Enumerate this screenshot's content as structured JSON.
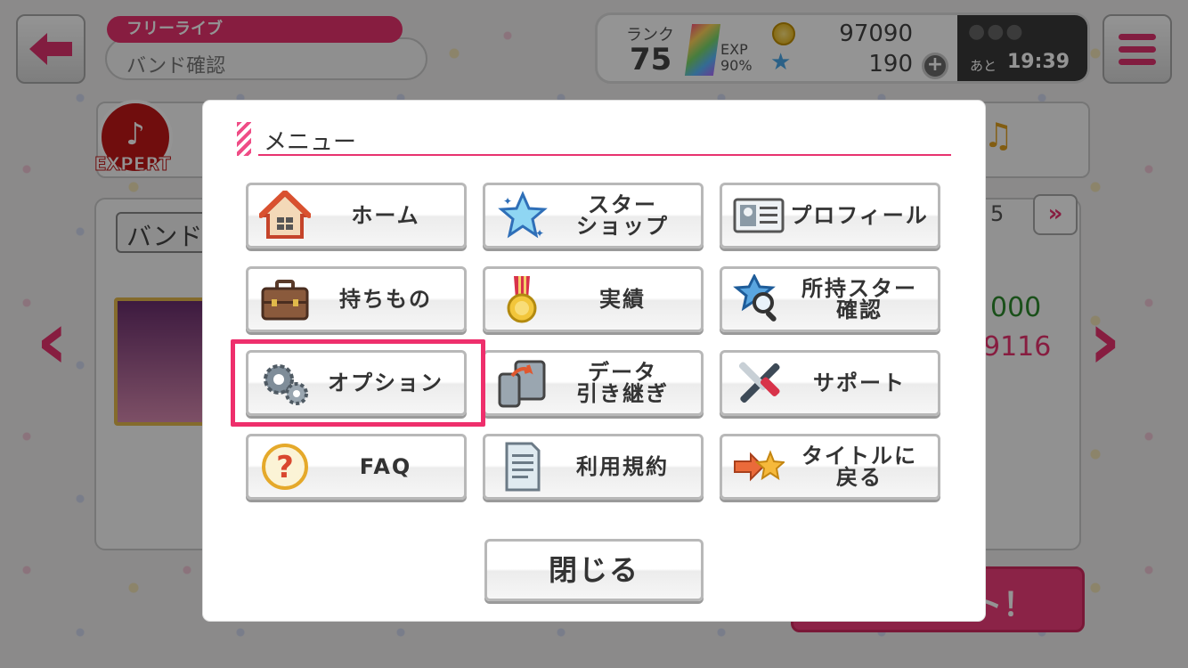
{
  "header": {
    "mode_label": "フリーライブ",
    "sub_label": "バンド確認"
  },
  "status": {
    "rank_label": "ランク",
    "rank_value": "75",
    "exp_label": "EXP",
    "exp_percent": "90%",
    "coins": "97090",
    "stars": "190",
    "plus_label": "+",
    "live_after_label": "あと",
    "live_time": "19:39"
  },
  "background": {
    "difficulty": "EXPERT",
    "band_select": "バンド",
    "page_indicator": "5",
    "score_green": "000",
    "score_pink": "9116",
    "start_label": "ト！"
  },
  "modal": {
    "title": "メニュー",
    "buttons": [
      {
        "label": "ホーム",
        "icon": "house-icon"
      },
      {
        "label": "スター\nショップ",
        "icon": "star-icon"
      },
      {
        "label": "プロフィール",
        "icon": "id-card-icon"
      },
      {
        "label": "持ちもの",
        "icon": "briefcase-icon"
      },
      {
        "label": "実績",
        "icon": "medal-icon"
      },
      {
        "label": "所持スター\n確認",
        "icon": "magnifier-star-icon"
      },
      {
        "label": "オプション",
        "icon": "gears-icon"
      },
      {
        "label": "データ\n引き継ぎ",
        "icon": "device-transfer-icon"
      },
      {
        "label": "サポート",
        "icon": "tools-icon"
      },
      {
        "label": "FAQ",
        "icon": "question-icon"
      },
      {
        "label": "利用規約",
        "icon": "document-icon"
      },
      {
        "label": "タイトルに\n戻る",
        "icon": "arrow-star-icon"
      }
    ],
    "close_label": "閉じる"
  },
  "colors": {
    "accent": "#e8336f",
    "highlight": "#ee2f6c"
  }
}
